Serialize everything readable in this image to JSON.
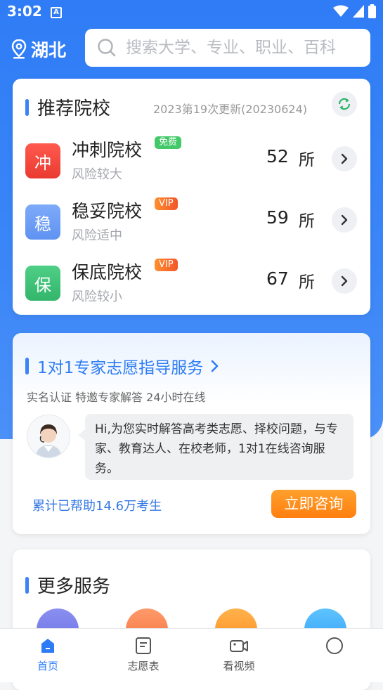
{
  "status_bar": {
    "time": "3:02",
    "app_badge": "A"
  },
  "header": {
    "location": "湖北",
    "search_placeholder": "搜索大学、专业、职业、百科"
  },
  "recommend": {
    "title": "推荐院校",
    "update_info": "2023第19次更新(20230624)",
    "rows": [
      {
        "badge": "冲",
        "name": "冲刺院校",
        "tag": "免费",
        "risk": "风险较大",
        "count": "52",
        "unit": "所",
        "badge_color": "#f0463c",
        "tag_color": "#43c96a"
      },
      {
        "badge": "稳",
        "name": "稳妥院校",
        "tag": "VIP",
        "risk": "风险适中",
        "count": "59",
        "unit": "所",
        "badge_color": "#6a9cf5",
        "tag_color": "#f36c2d"
      },
      {
        "badge": "保",
        "name": "保底院校",
        "tag": "VIP",
        "risk": "风险较小",
        "count": "67",
        "unit": "所",
        "badge_color": "#3fc07a",
        "tag_color": "#f36c2d"
      }
    ]
  },
  "expert": {
    "title": "1对1专家志愿指导服务",
    "subtitle": "实名认证 特邀专家解答 24小时在线",
    "message": "Hi,为您实时解答高考类志愿、择校问题，与专家、教育达人、在校老师，1对1在线咨询服务。",
    "helped": "累计已帮助14.6万考生",
    "consult_button": "立即咨询"
  },
  "more": {
    "title": "更多服务"
  },
  "nav": {
    "items": [
      {
        "label": "首页"
      },
      {
        "label": "志愿表"
      },
      {
        "label": "看视频"
      },
      {
        "label": ""
      }
    ]
  },
  "colors": {
    "primary": "#2e7cf5",
    "accent_orange": "#ff8a1a"
  }
}
